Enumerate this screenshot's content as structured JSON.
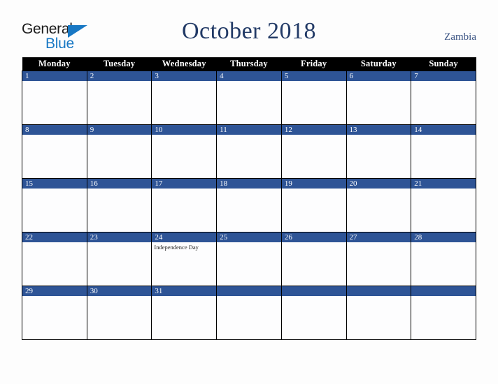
{
  "brand": {
    "name_part1": "General",
    "name_part2": "Blue",
    "triangle_icon": "blue-triangle-icon",
    "dark_color": "#1b1b1b",
    "blue_color": "#1878c4"
  },
  "header": {
    "title": "October 2018",
    "country": "Zambia",
    "title_color": "#223a66",
    "country_color": "#3a5383"
  },
  "calendar": {
    "weekday_headers": [
      "Monday",
      "Tuesday",
      "Wednesday",
      "Thursday",
      "Friday",
      "Saturday",
      "Sunday"
    ],
    "header_bg": "#000000",
    "daynum_bg": "#2e5496",
    "cell_bg": "#fdfdfe",
    "weeks": [
      [
        {
          "day": "1",
          "event": ""
        },
        {
          "day": "2",
          "event": ""
        },
        {
          "day": "3",
          "event": ""
        },
        {
          "day": "4",
          "event": ""
        },
        {
          "day": "5",
          "event": ""
        },
        {
          "day": "6",
          "event": ""
        },
        {
          "day": "7",
          "event": ""
        }
      ],
      [
        {
          "day": "8",
          "event": ""
        },
        {
          "day": "9",
          "event": ""
        },
        {
          "day": "10",
          "event": ""
        },
        {
          "day": "11",
          "event": ""
        },
        {
          "day": "12",
          "event": ""
        },
        {
          "day": "13",
          "event": ""
        },
        {
          "day": "14",
          "event": ""
        }
      ],
      [
        {
          "day": "15",
          "event": ""
        },
        {
          "day": "16",
          "event": ""
        },
        {
          "day": "17",
          "event": ""
        },
        {
          "day": "18",
          "event": ""
        },
        {
          "day": "19",
          "event": ""
        },
        {
          "day": "20",
          "event": ""
        },
        {
          "day": "21",
          "event": ""
        }
      ],
      [
        {
          "day": "22",
          "event": ""
        },
        {
          "day": "23",
          "event": ""
        },
        {
          "day": "24",
          "event": "Independence Day"
        },
        {
          "day": "25",
          "event": ""
        },
        {
          "day": "26",
          "event": ""
        },
        {
          "day": "27",
          "event": ""
        },
        {
          "day": "28",
          "event": ""
        }
      ],
      [
        {
          "day": "29",
          "event": ""
        },
        {
          "day": "30",
          "event": ""
        },
        {
          "day": "31",
          "event": ""
        },
        {
          "day": "",
          "event": ""
        },
        {
          "day": "",
          "event": ""
        },
        {
          "day": "",
          "event": ""
        },
        {
          "day": "",
          "event": ""
        }
      ]
    ]
  }
}
